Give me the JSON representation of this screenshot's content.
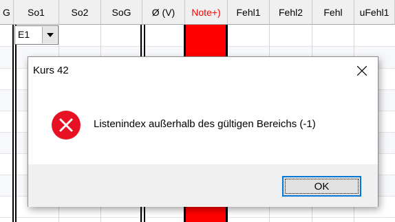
{
  "grid": {
    "first_col_fragment": "G",
    "columns": [
      "So1",
      "So2",
      "SoG",
      "Ø (V)",
      "Note+)",
      "Fehl1",
      "Fehl2",
      "Fehl",
      "uFehl1"
    ],
    "combo_value": "E1",
    "colors": {
      "header_bg": "#f0f0f0",
      "highlight_col": "#ff0000",
      "note_text": "#ff0000"
    }
  },
  "dialog": {
    "title": "Kurs 42",
    "close_icon": "close-icon",
    "icon": "error-icon",
    "message": "Listenindex außerhalb des gültigen Bereichs (-1)",
    "ok_label": "OK",
    "colors": {
      "error_red": "#e81123",
      "focus_border": "#0078d7"
    }
  }
}
